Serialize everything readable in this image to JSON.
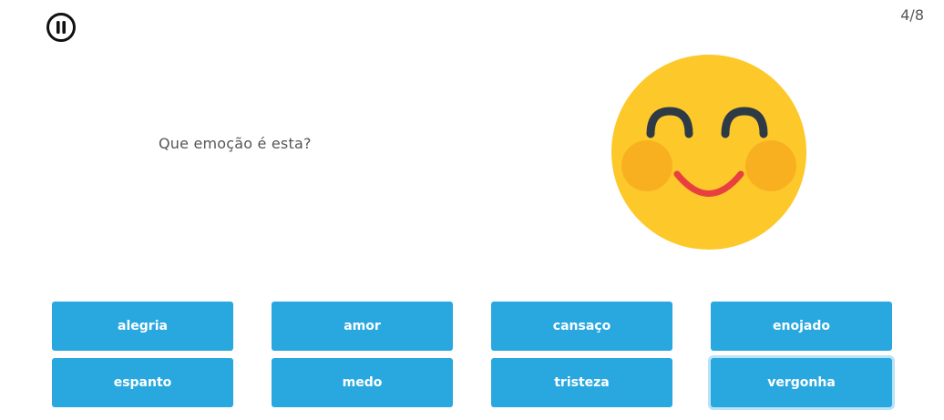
{
  "progress": "4/8",
  "question": "Que emoção é esta?",
  "emoji": {
    "name": "smiling-face-with-blush",
    "face_color": "#fdc82a",
    "cheek_color": "#f9b020",
    "eye_color": "#2e3a45",
    "mouth_color": "#e84040"
  },
  "answers": [
    {
      "label": "alegria"
    },
    {
      "label": "amor"
    },
    {
      "label": "cansaço"
    },
    {
      "label": "enojado"
    },
    {
      "label": "espanto"
    },
    {
      "label": "medo"
    },
    {
      "label": "tristeza"
    },
    {
      "label": "vergonha",
      "highlighted": true
    }
  ],
  "colors": {
    "answer_bg": "#29a8e0",
    "answer_text": "#ffffff",
    "highlight_ring": "#b9e3f6",
    "text": "#555555"
  }
}
